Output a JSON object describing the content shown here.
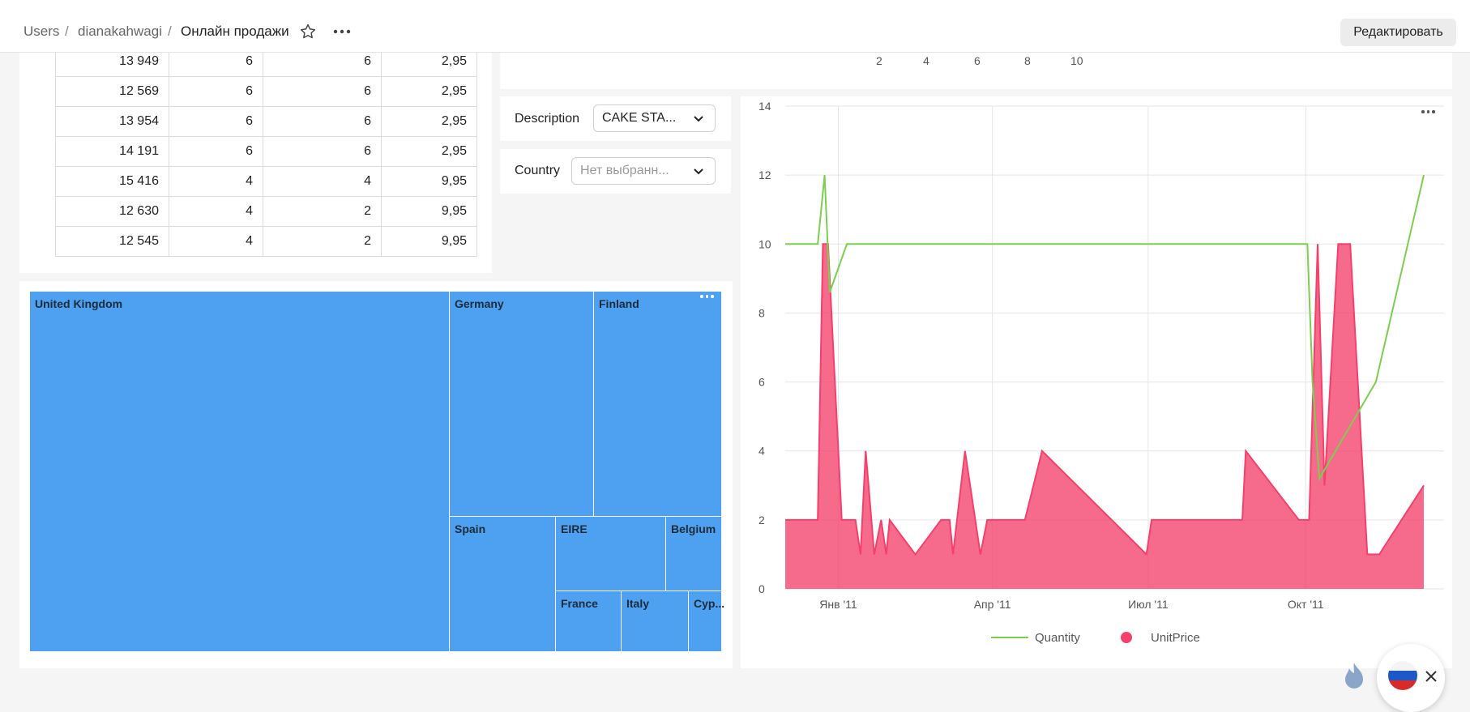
{
  "breadcrumb": {
    "items": [
      "Users",
      "dianakahwagi",
      "Онлайн продажи"
    ],
    "separator": "/"
  },
  "header": {
    "edit_label": "Редактировать"
  },
  "table": {
    "rows": [
      [
        "13 949",
        "6",
        "6",
        "2,95"
      ],
      [
        "12 569",
        "6",
        "6",
        "2,95"
      ],
      [
        "13 954",
        "6",
        "6",
        "2,95"
      ],
      [
        "14 191",
        "6",
        "6",
        "2,95"
      ],
      [
        "15 416",
        "4",
        "4",
        "9,95"
      ],
      [
        "12 630",
        "4",
        "2",
        "9,95"
      ],
      [
        "12 545",
        "4",
        "2",
        "9,95"
      ]
    ]
  },
  "top_chart": {
    "x_ticks": [
      "2",
      "4",
      "6",
      "8",
      "10"
    ]
  },
  "filters": {
    "description": {
      "label": "Description",
      "value": "CAKE STA..."
    },
    "country": {
      "label": "Country",
      "placeholder": "Нет выбранн..."
    }
  },
  "treemap": {
    "color": "#4ea1f0",
    "cells": [
      "United Kingdom",
      "Germany",
      "Finland",
      "Spain",
      "EIRE",
      "Belgium",
      "France",
      "Italy",
      "Cyp..."
    ]
  },
  "chart_data": {
    "type": "area",
    "xlabel": "",
    "ylabel": "",
    "ylim": [
      0,
      14
    ],
    "y_ticks": [
      "0",
      "2",
      "4",
      "6",
      "8",
      "10",
      "12",
      "14"
    ],
    "x_tick_labels": [
      "Янв '11",
      "Апр '11",
      "Июл '11",
      "Окт '11"
    ],
    "x_tick_dates": [
      "2011-01-01",
      "2011-04-01",
      "2011-07-01",
      "2011-10-01"
    ],
    "grid": true,
    "legend_position": "bottom",
    "series": [
      {
        "name": "Quantity",
        "type": "line",
        "color": "#7ccf4e",
        "points": [
          [
            "2010-12-01",
            10
          ],
          [
            "2010-12-20",
            10
          ],
          [
            "2010-12-24",
            12
          ],
          [
            "2010-12-27",
            8.6
          ],
          [
            "2011-01-06",
            10
          ],
          [
            "2011-09-26",
            10
          ],
          [
            "2011-10-02",
            10
          ],
          [
            "2011-10-05",
            6
          ],
          [
            "2011-10-09",
            3.2
          ],
          [
            "2011-11-11",
            6
          ],
          [
            "2011-12-09",
            12
          ]
        ]
      },
      {
        "name": "UnitPrice",
        "type": "area",
        "color": "#f4406a",
        "points": [
          [
            "2010-12-01",
            2
          ],
          [
            "2010-12-20",
            2
          ],
          [
            "2010-12-23",
            10
          ],
          [
            "2010-12-26",
            10
          ],
          [
            "2011-01-03",
            2
          ],
          [
            "2011-01-11",
            2
          ],
          [
            "2011-01-14",
            1
          ],
          [
            "2011-01-17",
            4
          ],
          [
            "2011-01-22",
            1
          ],
          [
            "2011-01-26",
            2
          ],
          [
            "2011-01-29",
            1
          ],
          [
            "2011-01-31",
            2
          ],
          [
            "2011-02-15",
            1
          ],
          [
            "2011-03-02",
            2
          ],
          [
            "2011-03-07",
            2
          ],
          [
            "2011-03-09",
            1
          ],
          [
            "2011-03-16",
            4
          ],
          [
            "2011-03-25",
            1
          ],
          [
            "2011-03-29",
            2
          ],
          [
            "2011-04-20",
            2
          ],
          [
            "2011-04-30",
            4
          ],
          [
            "2011-06-30",
            1
          ],
          [
            "2011-07-03",
            2
          ],
          [
            "2011-08-25",
            2
          ],
          [
            "2011-08-27",
            4
          ],
          [
            "2011-09-27",
            2
          ],
          [
            "2011-10-03",
            2
          ],
          [
            "2011-10-08",
            10
          ],
          [
            "2011-10-12",
            3
          ],
          [
            "2011-10-20",
            10
          ],
          [
            "2011-10-27",
            10
          ],
          [
            "2011-11-06",
            1
          ],
          [
            "2011-11-13",
            1
          ],
          [
            "2011-12-09",
            3
          ]
        ]
      }
    ]
  }
}
